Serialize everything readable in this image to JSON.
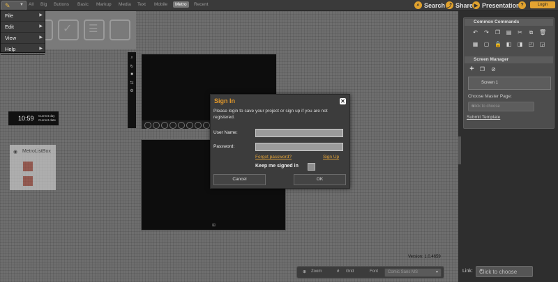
{
  "topbar": {
    "tabs": [
      "All",
      "Big",
      "Buttons",
      "Basic",
      "Markup",
      "Media",
      "Text",
      "Mobile",
      "Metro",
      "Recent"
    ],
    "active_tab": "Metro",
    "search_label": "Search",
    "share_label": "Share",
    "presentation_label": "Presentation",
    "help_label": "?",
    "login_label": "Login"
  },
  "menu": {
    "items": [
      "File",
      "Edit",
      "View",
      "Help"
    ]
  },
  "canvas": {
    "clock_time": "10:59",
    "clock_day": "Current day",
    "clock_date": "Current date",
    "listbox_title": "MetroListBox",
    "version": "Version: 1.0.4659"
  },
  "bottombar": {
    "zoom_label": "Zoom",
    "grid_label": "Grid",
    "font_label": "Font",
    "font_value": "Comic Sans MS"
  },
  "right_panel": {
    "common_commands_title": "Common Commands",
    "screen_manager_title": "Screen Manager",
    "screen_name": "Screen 1",
    "master_page_label": "Choose Master Page:",
    "master_page_placeholder": "Click to choose",
    "submit_template_label": "Submit Template",
    "link_label": "Link:",
    "link_value": "Click to choose"
  },
  "dialog": {
    "title": "Sign In",
    "message": "Please login to save your project or sign up if you are not registered.",
    "username_label": "User Name:",
    "password_label": "Password:",
    "forgot_label": "Forgot password?",
    "signup_label": "Sign Up",
    "keep_label": "Keep me signed in",
    "cancel_label": "Cancel",
    "ok_label": "OK"
  },
  "colors": {
    "accent": "#e59a2a",
    "panel": "#4d4d4d",
    "canvas": "#6e6e6e"
  }
}
